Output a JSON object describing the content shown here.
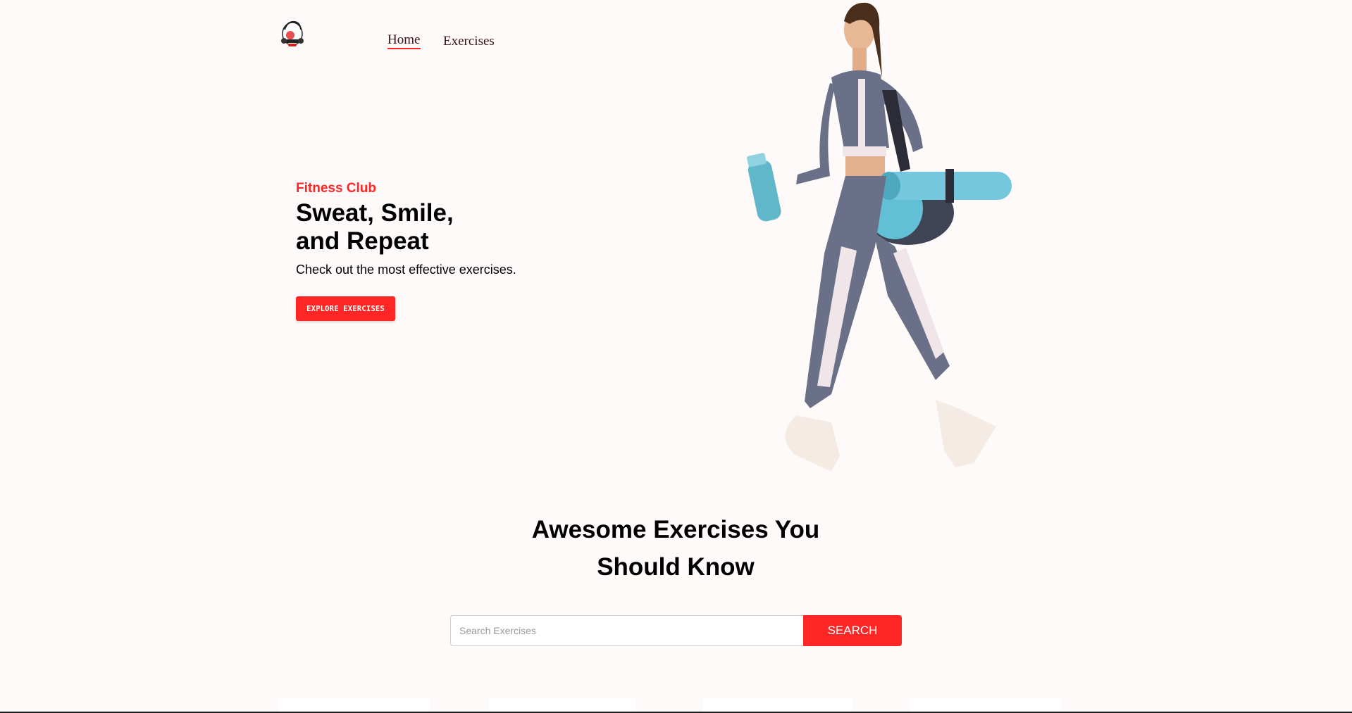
{
  "navbar": {
    "logo_icon": "gym-logo-icon",
    "home_label": "Home",
    "exercises_label": "Exercises",
    "active_color": "#ff2625"
  },
  "hero": {
    "tag": "Fitness Club",
    "title_line1": "Sweat, Smile,",
    "title_line2": "and Repeat",
    "subtitle": "Check out the most effective exercises.",
    "button_label": "EXPLORE EXERCISES",
    "image": "woman-walking-with-gym-bag"
  },
  "search": {
    "heading_line1": "Awesome Exercises You",
    "heading_line2": "Should Know",
    "placeholder": "Search Exercises",
    "button_label": "SEARCH"
  },
  "colors": {
    "accent": "#ff2625",
    "background": "#fffafa"
  }
}
